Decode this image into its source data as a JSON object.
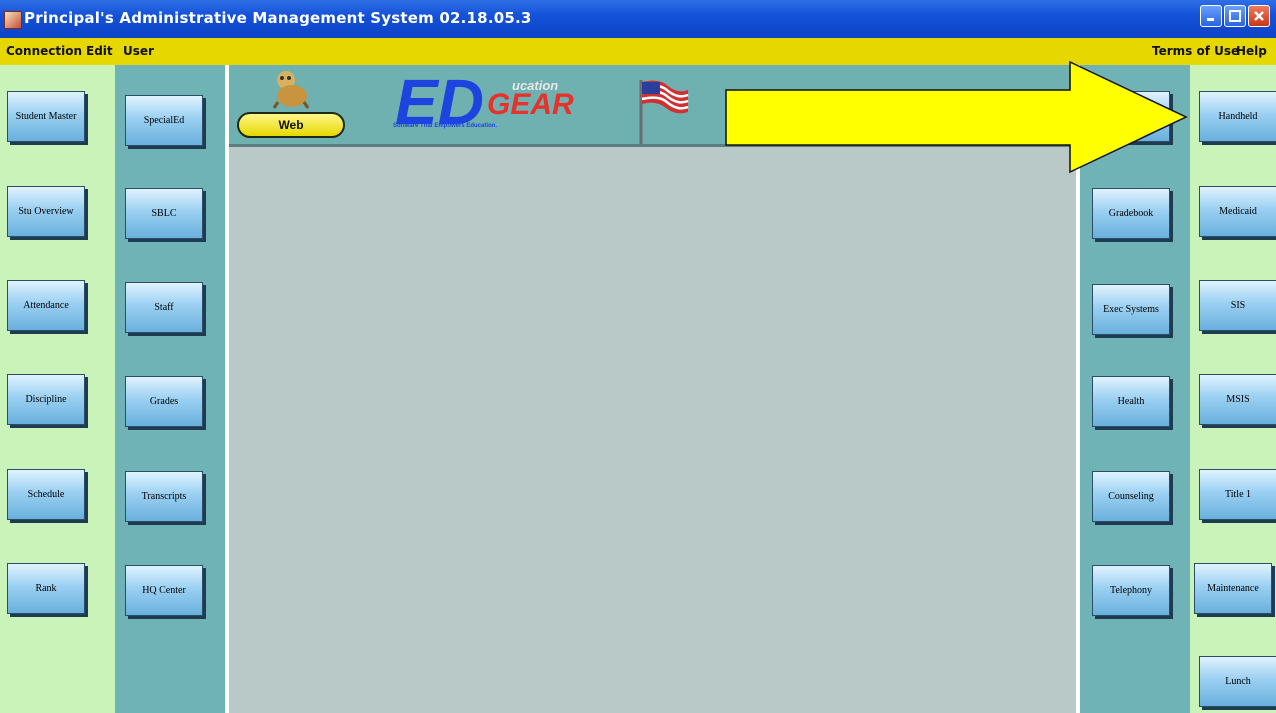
{
  "window": {
    "title": "Principal's Administrative Management System   02.18.05.3"
  },
  "menu": {
    "left": [
      "Connection",
      "Edit",
      "User"
    ],
    "right": [
      "Terms of Use",
      "Help"
    ]
  },
  "banner": {
    "web_label": "Web",
    "logo_main": "ED",
    "logo_ucation": "ucation",
    "logo_gear": "GEAR",
    "logo_tagline": "Software That Empowers Education."
  },
  "nav": {
    "col_a": [
      "Student Master",
      "Stu Overview",
      "Attendance",
      "Discipline",
      "Schedule",
      "Rank"
    ],
    "col_b": [
      "SpecialEd",
      "SBLC",
      "Staff",
      "Grades",
      "Transcripts",
      "HQ Center"
    ],
    "col_c": [
      "Gradebook",
      "Exec Systems",
      "Health",
      "Counseling",
      "Telephony"
    ],
    "col_d": [
      "Handheld",
      "Medicaid",
      "SIS",
      "MSIS",
      "Title 1",
      "Maintenance",
      "Lunch"
    ]
  },
  "colors": {
    "titlebar": "#1452d8",
    "menubar": "#e6d700",
    "light_column": "#c9f3b8",
    "teal_column": "#6fb3b6",
    "content": "#b9c9c7",
    "annotation_arrow": "#ffff00"
  },
  "icons": {
    "app": "app-icon",
    "minimize": "minimize-icon",
    "maximize": "maximize-icon",
    "close": "close-icon",
    "flag": "us-flag-icon",
    "mascot": "mascot-icon",
    "annotation": "arrow-annotation"
  }
}
